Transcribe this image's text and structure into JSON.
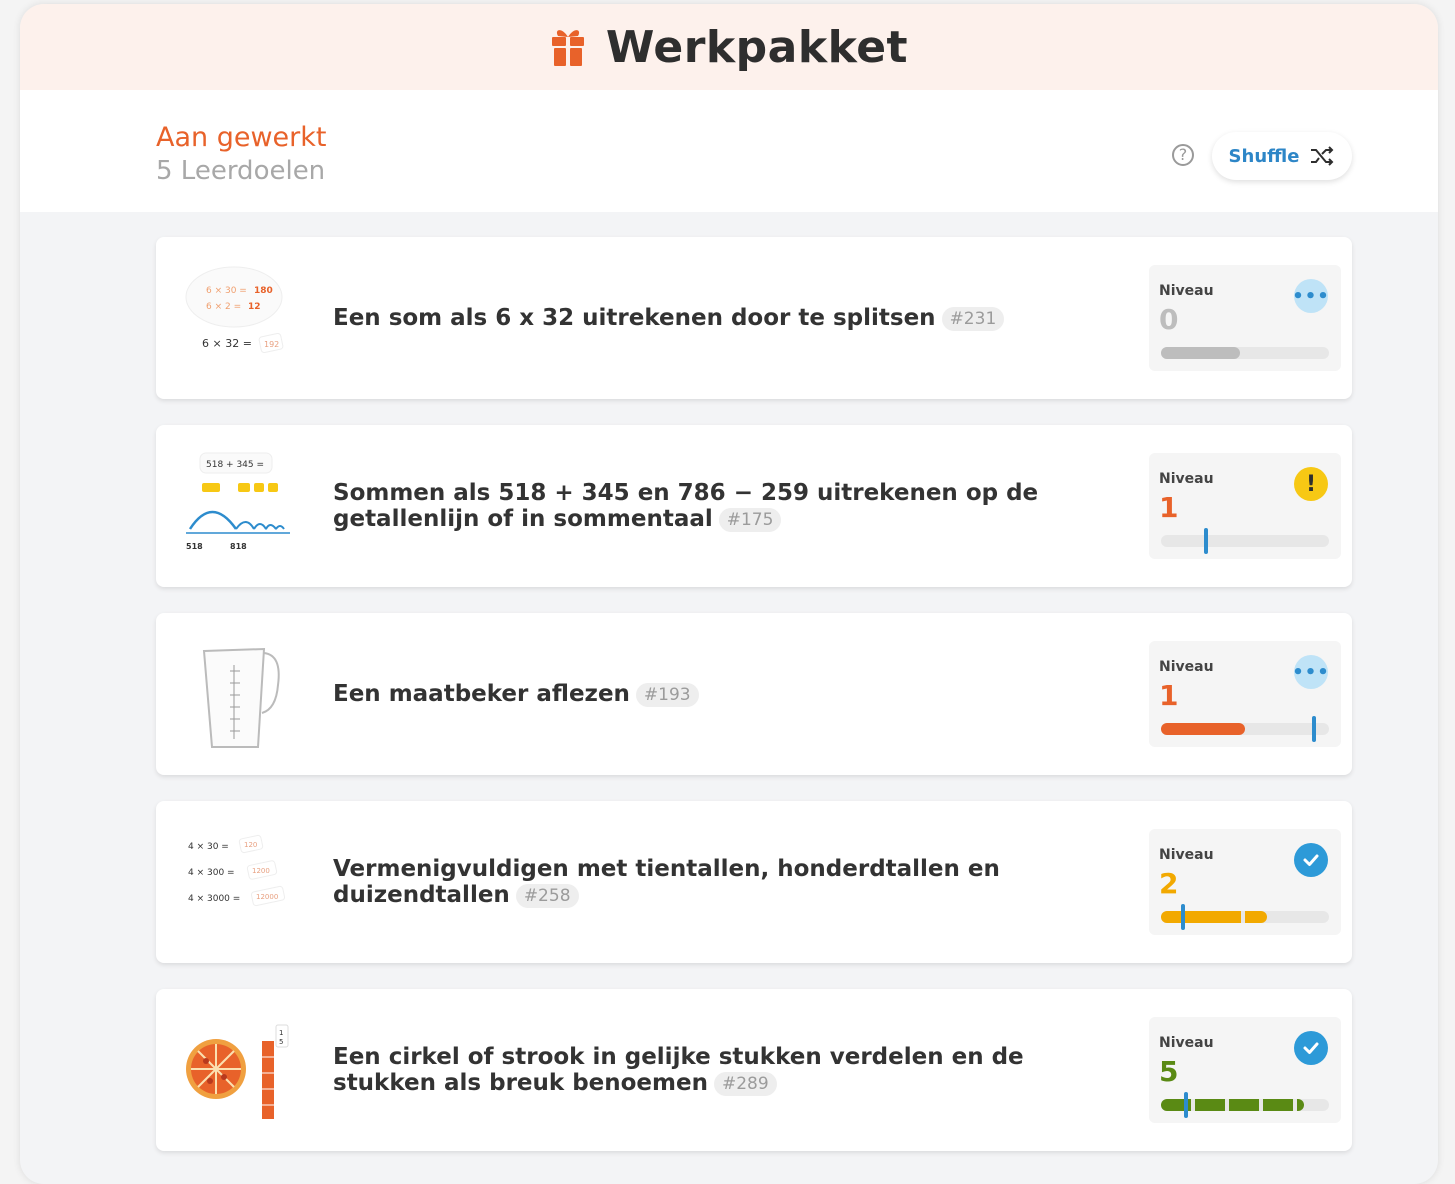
{
  "header": {
    "title": "Werkpakket",
    "icon": "gift-icon",
    "accent": "#e8622a"
  },
  "subheader": {
    "status": "Aan gewerkt",
    "count": "5 Leerdoelen",
    "help_icon": "question-circle-icon",
    "shuffle_label": "Shuffle",
    "shuffle_icon": "shuffle-icon"
  },
  "level_label": "Niveau",
  "colors": {
    "level0": "#bdbdbd",
    "level1": "#e8622a",
    "level2": "#f2a900",
    "level5": "#5a8a14",
    "marker": "#2d8ccd"
  },
  "goals": [
    {
      "title": "Een som als 6 x 32 uitrekenen door te splitsen",
      "code": "#231",
      "level": "0",
      "status": "pending",
      "status_icon": "ellipsis-icon",
      "progress": 0.47,
      "illus": {
        "l1": "6 × 30 = 180",
        "l2": "6 × 2 = 12",
        "l3": "6 × 32 =",
        "l3b": "192"
      }
    },
    {
      "title": "Sommen als 518 + 345 en 786 − 259 uitrekenen op de getallenlijn of in sommentaal",
      "code": "#175",
      "level": "1",
      "status": "warning",
      "status_icon": "exclamation-icon",
      "progress": 0.0,
      "marker": 0.27,
      "illus": {
        "l1": "518 + 345 =",
        "a": "518",
        "b": "818"
      }
    },
    {
      "title": "Een maatbeker aflezen",
      "code": "#193",
      "level": "1",
      "status": "pending",
      "status_icon": "ellipsis-icon",
      "progress": 0.5,
      "marker": 0.91,
      "illus": {}
    },
    {
      "title": "Vermenigvuldigen met tientallen, honderdtallen en duizendtallen",
      "code": "#258",
      "level": "2",
      "status": "done",
      "status_icon": "check-icon",
      "progress": 0.63,
      "marker": 0.13,
      "illus": {
        "l1": "4 × 30 =",
        "l1b": "120",
        "l2": "4 × 300 =",
        "l2b": "1200",
        "l3": "4 × 3000 =",
        "l3b": "12000"
      }
    },
    {
      "title": "Een cirkel of strook in gelijke stukken verdelen en de stukken als breuk benoemen",
      "code": "#289",
      "level": "5",
      "status": "done",
      "status_icon": "check-icon",
      "progress": 0.85,
      "marker": 0.15,
      "illus": {
        "f1": "1/8",
        "f2": "1/5"
      }
    }
  ]
}
